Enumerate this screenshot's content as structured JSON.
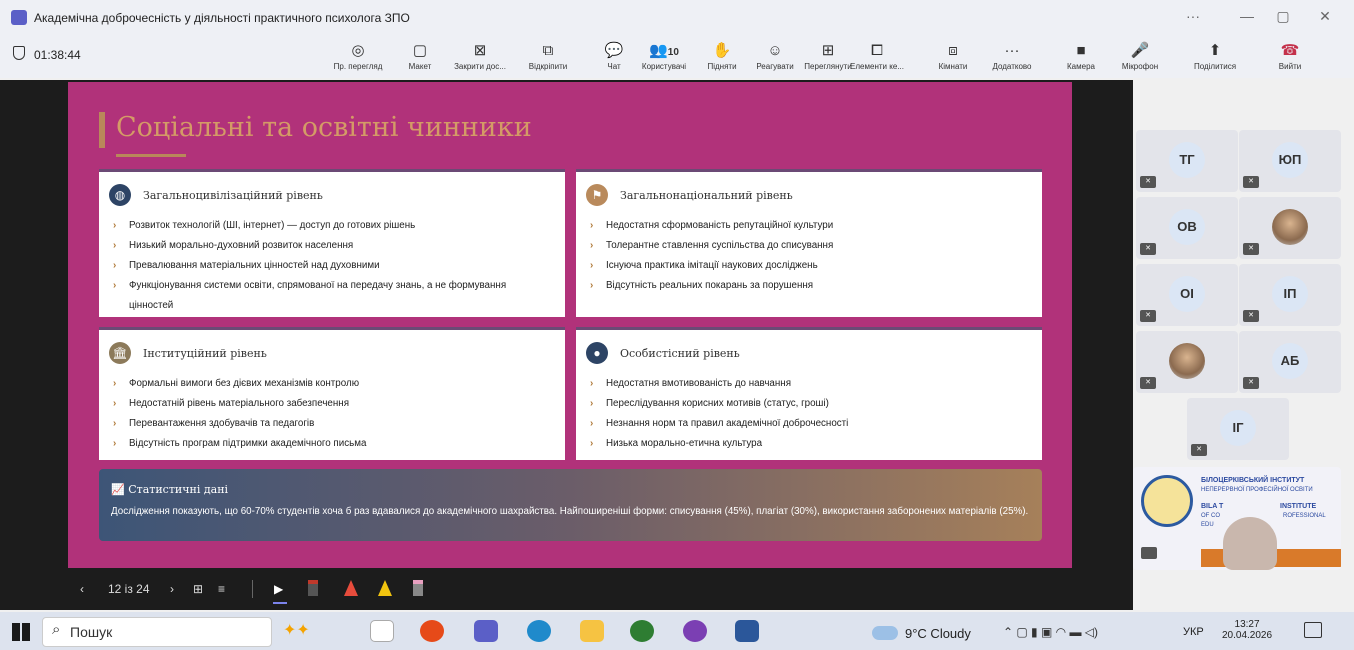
{
  "window": {
    "title": "Академічна доброчесність у діяльності практичного психолога ЗПО"
  },
  "meeting": {
    "timer": "01:38:44"
  },
  "toolbar": [
    {
      "label": "Пр. перегляд",
      "icon": "eye-icon",
      "glyph": "◎"
    },
    {
      "label": "Макет",
      "icon": "layout-icon",
      "glyph": "▢"
    },
    {
      "label": "Закрити дос...",
      "icon": "stop-share-icon",
      "glyph": "⊠"
    },
    {
      "label": "Відкріпити",
      "icon": "unpin-icon",
      "glyph": "⧉"
    },
    {
      "label": "Чат",
      "icon": "chat-icon",
      "glyph": "💬"
    },
    {
      "label": "Користувачі",
      "icon": "people-icon",
      "glyph": "👥"
    },
    {
      "label": "Підняти",
      "icon": "raise-hand-icon",
      "glyph": "✋"
    },
    {
      "label": "Реагувати",
      "icon": "react-icon",
      "glyph": "☺"
    },
    {
      "label": "Переглянути",
      "icon": "view-icon",
      "glyph": "⊞"
    },
    {
      "label": "Елементи ке...",
      "icon": "apps-icon",
      "glyph": "⧠"
    },
    {
      "label": "Кімнати",
      "icon": "rooms-icon",
      "glyph": "⧈"
    },
    {
      "label": "Додатково",
      "icon": "more-icon",
      "glyph": "···"
    },
    {
      "label": "Камера",
      "icon": "camera-icon",
      "glyph": "■"
    },
    {
      "label": "Мікрофон",
      "icon": "mic-icon",
      "glyph": "🎤"
    },
    {
      "label": "Поділитися",
      "icon": "share-icon",
      "glyph": "⬆"
    },
    {
      "label": "Вийти",
      "icon": "leave-icon",
      "glyph": "☎"
    }
  ],
  "participants_count": "10",
  "slide": {
    "title": "Соціальні та освітні чинники",
    "cards": [
      {
        "title": "Загальноцивілізаційний рівень",
        "icon": "globe-icon",
        "color": "#2d4465",
        "items": [
          "Розвиток технологій (ШІ, інтернет) — доступ до готових рішень",
          "Низький морально-духовний розвиток населення",
          "Превалювання матеріальних цінностей над духовними",
          "Функціонування системи освіти, спрямованої на передачу знань, а не формування цінностей"
        ]
      },
      {
        "title": "Загальнонаціональний рівень",
        "icon": "flag-icon",
        "color": "#b98a5c",
        "items": [
          "Недостатня сформованість репутаційної культури",
          "Толерантне ставлення суспільства до списування",
          "Існуюча практика імітації наукових досліджень",
          "Відсутність реальних покарань за порушення"
        ]
      },
      {
        "title": "Інституційний рівень",
        "icon": "institution-icon",
        "color": "#8c7a5a",
        "items": [
          "Формальні вимоги без дієвих механізмів контролю",
          "Недостатній рівень матеріального забезпечення",
          "Перевантаження здобувачів та педагогів",
          "Відсутність програм підтримки академічного письма"
        ]
      },
      {
        "title": "Особистісний рівень",
        "icon": "user-icon",
        "color": "#2d4465",
        "items": [
          "Недостатня вмотивованість до навчання",
          "Переслідування корисних мотивів (статус, гроші)",
          "Незнання норм та правил академічної доброчесності",
          "Низька морально-етична культура"
        ]
      }
    ],
    "stats": {
      "title": "Статистичні дані",
      "text": "Дослідження показують, що 60-70% студентів хоча б раз вдавалися до академічного шахрайства. Найпоширеніші форми: списування (45%), плагіат (30%), використання заборонених матеріалів (25%)."
    }
  },
  "nav": {
    "page": "12 із 24"
  },
  "participants": [
    "ТГ",
    "ЮП",
    "ОВ",
    "",
    "ОІ",
    "ІП",
    "",
    "АБ",
    "ІГ"
  ],
  "institute": {
    "line1": "БІЛОЦЕРКІВСЬКИЙ ІНСТИТУТ",
    "line2": "НЕПЕРЕРВНОЇ ПРОФЕСІЙНОЇ ОСВІТИ",
    "line3": "BILA T",
    "line4": "INSTITUTE",
    "line5": "OF CO",
    "line6": "ROFESSIONAL",
    "line7": "EDU"
  },
  "taskbar": {
    "search": "Пошук",
    "weather": "9°C  Cloudy",
    "lang": "УКР",
    "time": "13:27",
    "date": "20.04.2026"
  }
}
